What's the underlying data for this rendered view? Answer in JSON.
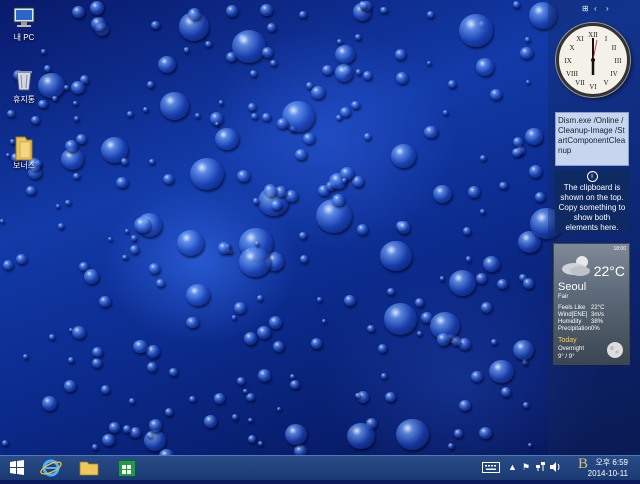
{
  "desktop_icons": [
    {
      "label": "내 PC",
      "icon": "computer-icon"
    },
    {
      "label": "휴지통",
      "icon": "recycle-bin-icon"
    },
    {
      "label": "보너스",
      "icon": "folder-icon"
    }
  ],
  "clipboard_gadget": {
    "content": "Dism.exe /Online /Cleanup-Image /StartComponentCleanup",
    "info_icon": "i",
    "message": "The clipboard is shown on the top. Copy something to show both elements here."
  },
  "weather_gadget": {
    "time": "18:00",
    "temperature": "22°C",
    "city": "Seoul",
    "condition": "Fair",
    "rows": [
      {
        "label": "Feels Like",
        "value": "22°C"
      },
      {
        "label": "Wind[ENE]",
        "value": "3m/s"
      },
      {
        "label": "Humidity",
        "value": "38%"
      },
      {
        "label": "Precipitation",
        "value": "0%"
      }
    ],
    "today_label": "Today",
    "overnight_label": "Overnight",
    "low_high": "9° / 9°"
  },
  "clock_gadget": {
    "hour": 0,
    "minute": 0
  },
  "taskbar": {
    "pinned": [
      {
        "name": "start-button",
        "icon": "windows-logo-icon"
      },
      {
        "name": "internet-explorer-button",
        "icon": "ie-icon"
      },
      {
        "name": "file-explorer-button",
        "icon": "folder-icon"
      },
      {
        "name": "store-button",
        "icon": "store-icon"
      }
    ],
    "tray_time": "오후 6:59",
    "tray_date": "2014-10-11",
    "tray_icons": [
      "keyboard-icon",
      "chevron-up-icon",
      "flag-icon",
      "network-icon",
      "volume-icon"
    ]
  },
  "watermark": "B"
}
